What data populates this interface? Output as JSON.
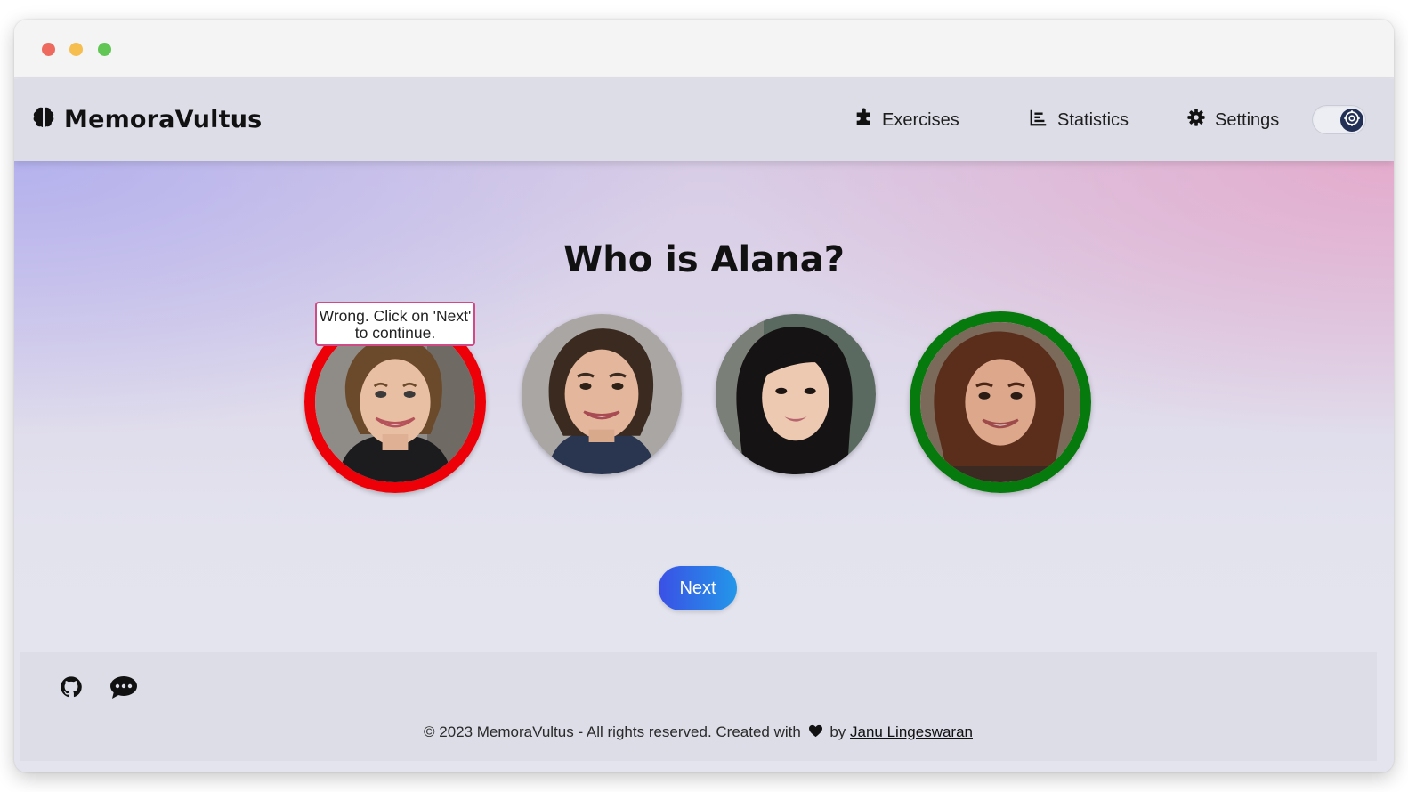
{
  "app": {
    "brand": "MemoraVultus"
  },
  "nav": {
    "items": [
      {
        "label": "Exercises",
        "icon": "puzzle-icon"
      },
      {
        "label": "Statistics",
        "icon": "chart-icon"
      },
      {
        "label": "Settings",
        "icon": "gear-icon"
      }
    ],
    "theme_toggle_icon": "gear-icon"
  },
  "quiz": {
    "question": "Who is Alana?",
    "feedback": "Wrong. Click on 'Next' to continue.",
    "faces": [
      {
        "state": "wrong",
        "ring_color": "#ee0008"
      },
      {
        "state": "neutral"
      },
      {
        "state": "neutral"
      },
      {
        "state": "correct",
        "ring_color": "#067a0c"
      }
    ],
    "next_label": "Next"
  },
  "footer": {
    "icons": [
      "github-icon",
      "chat-icon"
    ],
    "copyright_prefix": "© 2023 MemoraVultus - All rights reserved. Created with",
    "copyright_by": "by",
    "author": "Janu Lingeswaran"
  },
  "colors": {
    "wrong": "#ee0008",
    "correct": "#067a0c",
    "button_gradient_start": "#3a50e6",
    "button_gradient_end": "#2397e8",
    "feedback_border": "#d04a86"
  }
}
